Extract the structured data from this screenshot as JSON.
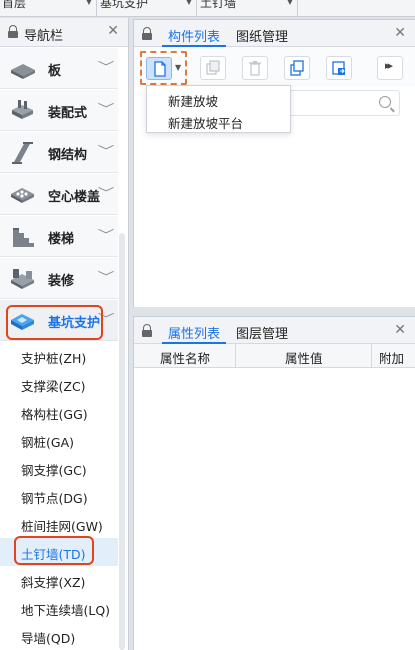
{
  "top_selectors": [
    "首层",
    "基坑支护",
    "土钉墙"
  ],
  "nav": {
    "title": "导航栏",
    "categories": [
      {
        "label": "板",
        "icon": "slab-icon"
      },
      {
        "label": "装配式",
        "icon": "prefab-icon"
      },
      {
        "label": "钢结构",
        "icon": "steel-structure-icon"
      },
      {
        "label": "空心楼盖",
        "icon": "hollow-floor-icon"
      },
      {
        "label": "楼梯",
        "icon": "stairs-icon"
      },
      {
        "label": "装修",
        "icon": "decoration-icon"
      },
      {
        "label": "基坑支护",
        "icon": "foundation-pit-icon"
      }
    ],
    "sub_items": [
      "支护桩(ZH)",
      "支撑梁(ZC)",
      "格构柱(GG)",
      "钢桩(GA)",
      "钢支撑(GC)",
      "钢节点(DG)",
      "桩间挂网(GW)",
      "土钉墙(TD)",
      "斜支撑(XZ)",
      "地下连续墙(LQ)",
      "导墙(QD)"
    ]
  },
  "component_panel": {
    "tabs": [
      "构件列表",
      "图纸管理"
    ],
    "dropdown_items": [
      "新建放坡",
      "新建放坡平台"
    ]
  },
  "property_panel": {
    "tabs": [
      "属性列表",
      "图层管理"
    ],
    "columns": [
      "属性名称",
      "属性值",
      "附加"
    ]
  },
  "colors": {
    "accent": "#1a73e8",
    "highlight": "#e0451c"
  }
}
